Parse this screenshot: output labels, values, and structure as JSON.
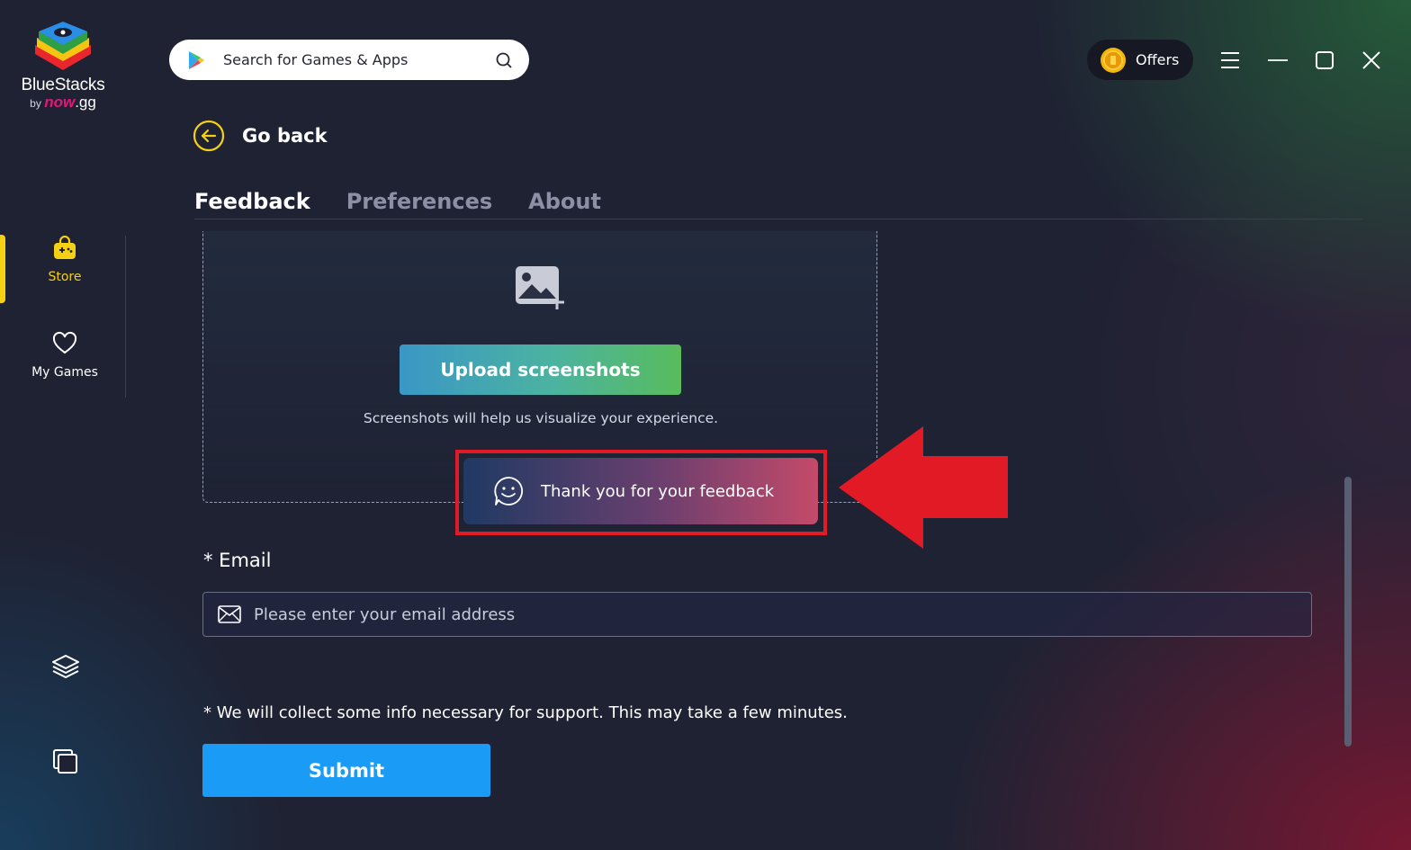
{
  "app": {
    "brand_name": "BlueStacks",
    "brand_by": "by",
    "brand_now": "now",
    "brand_gg": ".gg"
  },
  "sidebar": {
    "items": [
      {
        "label": "Store",
        "icon": "store-bag-icon",
        "active": true
      },
      {
        "label": "My Games",
        "icon": "heart-icon",
        "active": false
      }
    ],
    "bottom_icons": [
      "layers-icon",
      "multi-instance-icon"
    ]
  },
  "search": {
    "placeholder": "Search for Games & Apps"
  },
  "topbar": {
    "offers_label": "Offers"
  },
  "nav": {
    "go_back": "Go back"
  },
  "tabs": [
    {
      "label": "Feedback",
      "active": true
    },
    {
      "label": "Preferences",
      "active": false
    },
    {
      "label": "About",
      "active": false
    }
  ],
  "upload": {
    "button_label": "Upload screenshots",
    "hint": "Screenshots will help us visualize your experience."
  },
  "toast": {
    "message": "Thank you for your feedback"
  },
  "email": {
    "label": "* Email",
    "placeholder": "Please enter your email address",
    "value": ""
  },
  "note": "* We will collect some info necessary for support. This may take a few minutes.",
  "submit_label": "Submit",
  "colors": {
    "accent_yellow": "#f6d013",
    "submit_blue": "#1a9cf6",
    "highlight_red": "#e11a25"
  }
}
